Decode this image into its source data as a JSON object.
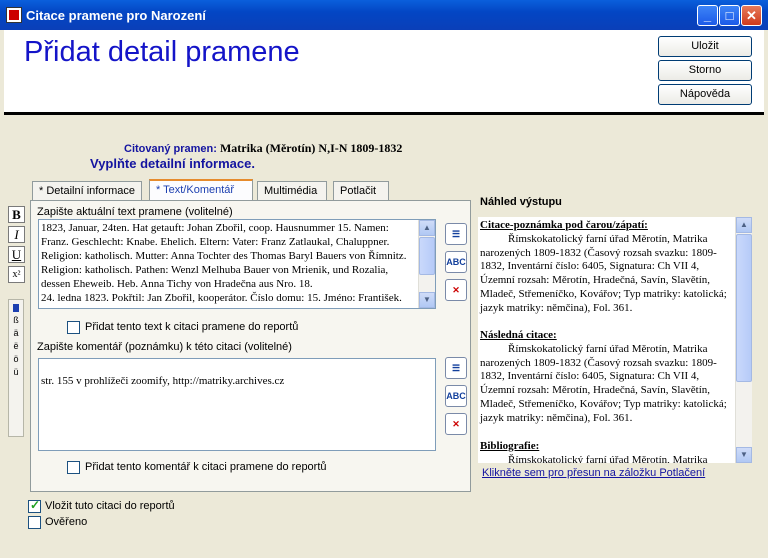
{
  "window": {
    "title": "Citace pramene pro Narození"
  },
  "header": {
    "title": "Přidat detail pramene",
    "save_label": "Uložit",
    "cancel_label": "Storno",
    "help_label": "Nápověda"
  },
  "source": {
    "label": "Citovaný pramen:",
    "name": "Matrika (Měrotín) N,I-N 1809-1832",
    "instruction": "Vyplňte detailní informace."
  },
  "tabs": [
    {
      "label": "* Detailní informace"
    },
    {
      "label": "* Text/Komentář"
    },
    {
      "label": "Multimédia"
    },
    {
      "label": "Potlačit"
    }
  ],
  "text_section": {
    "label": "Zapište aktuální text pramene (volitelné)",
    "value": "1823, Januar, 24ten. Hat getauft: Johan Zbořil, coop. Hausnummer 15. Namen: Franz. Geschlecht: Knabe. Ehelich. Eltern: Vater: Franz Zatlaukal, Chaluppner. Religion: katholisch. Mutter: Anna Tochter des Thomas Baryl Bauers von Římnitz. Religion: katholisch. Pathen: Wenzl Melhuba Bauer von Mrienik, und Rozalia, dessen Eheweib. Heb. Anna Tichy von Hradečna aus Nro. 18.\n24. ledna 1823. Pokřtil: Jan Zbořil, kooperátor. Číslo domu: 15. Jméno: František. Pohlaví: chlapec. Manželský. Rodiče: Otec: František Zatloukal",
    "include_label": "Přidat tento text k citaci pramene do reportů",
    "include_checked": false
  },
  "comment_section": {
    "label": "Zapište komentář (poznámku) k této citaci (volitelné)",
    "value": "str. 155 v prohlížeči zoomify, http://matriky.archives.cz",
    "include_label": "Přidat tento komentář k citaci pramene do reportů",
    "include_checked": false
  },
  "format_toolbar": {
    "bold": "B",
    "italic": "I",
    "underline": "U",
    "superscript": "x²"
  },
  "special_chars": [
    "ß",
    "ä",
    "ë",
    "ö",
    "ü"
  ],
  "tool_buttons": {
    "edit": "edit-text",
    "spell": "ABC",
    "clear": "HTM"
  },
  "bottom": {
    "include_citation_label": "Vložit tuto citaci do reportů",
    "include_citation_checked": true,
    "verified_label": "Ověřeno",
    "verified_checked": false
  },
  "preview": {
    "title": "Náhled výstupu",
    "footnote_header": "Citace-poznámka pod čarou/zápatí:",
    "footnote_text": "Římskokatolický farní úřad Měrotín, Matrika narozených 1809-1832 (Časový rozsah svazku: 1809-1832, Inventární číslo: 6405, Signatura: Ch VII 4, Územní rozsah: Měrotín, Hradečná, Savín, Slavětín, Mladeč, Střemeníčko, Kovářov; Typ matriky: katolická; jazyk matriky: němčina), Fol. 361.",
    "subsequent_header": "Následná citace:",
    "subsequent_text": "Římskokatolický farní úřad Měrotín, Matrika narozených 1809-1832 (Časový rozsah svazku: 1809-1832, Inventární číslo: 6405, Signatura: Ch VII 4, Územní rozsah: Měrotín, Hradečná, Savín, Slavětín, Mladeč, Střemeníčko, Kovářov; Typ matriky: katolická; jazyk matriky: němčina), Fol. 361.",
    "bibliography_header": "Bibliografie:",
    "bibliography_text": "Římskokatolický farní úřad Měrotín, Matrika",
    "suppress_link": "Klikněte sem pro přesun na záložku Potlačení"
  }
}
